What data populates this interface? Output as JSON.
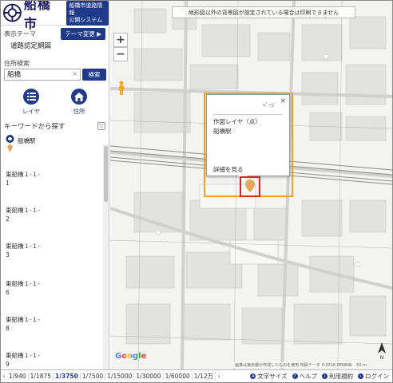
{
  "header": {
    "city_name": "船橋市",
    "system_line1": "船橋市道路情報",
    "system_line2": "公開システム"
  },
  "theme": {
    "label": "表示テーマ",
    "change_button": "テーマ変更 ▶",
    "current": "道路認定網図"
  },
  "address_search": {
    "label": "住所検索",
    "value": "船橋",
    "clear": "×",
    "button": "検索"
  },
  "tools": {
    "layer_label": "レイヤ",
    "home_label": "住所"
  },
  "keyword": {
    "title": "キーワードから探す",
    "collapse": "▽",
    "first_result": "船橋駅",
    "items": [
      "東船橋１-１-\n1",
      "東船橋１-１-\n2",
      "東船橋１-１-\n3",
      "東船橋１-１-\n6",
      "東船橋１-１-\n8",
      "東船橋１-１-\n9"
    ]
  },
  "map": {
    "notice": "地形図以外の背景図が設定されている場合は印刷できません",
    "zoom_in": "+",
    "zoom_out": "−",
    "popup": {
      "tab": "ﾍﾟｰｼﾞ",
      "close": "×",
      "layer": "作図レイヤ（点）",
      "name": "船橋駅",
      "detail": "詳細を見る"
    },
    "google": "Google",
    "copyright": "画像は東京都が作成したものを使用 地図データ ©2018 ZENRIN",
    "scale_bar": "50 m",
    "north": "N"
  },
  "footer": {
    "prev": "‹",
    "scales": [
      "1/940",
      "1/1875",
      "1/3750",
      "1/7500",
      "1/15000",
      "1/30000",
      "1/60000",
      "1/12万"
    ],
    "next": "›",
    "active_scale": "1/3750",
    "links": [
      "文字サイズ",
      "ヘルプ",
      "利用規約",
      "ログイン"
    ]
  },
  "colors": {
    "brand": "#1f3a8a",
    "highlight": "#f4a021",
    "marker": "#d9242b"
  }
}
